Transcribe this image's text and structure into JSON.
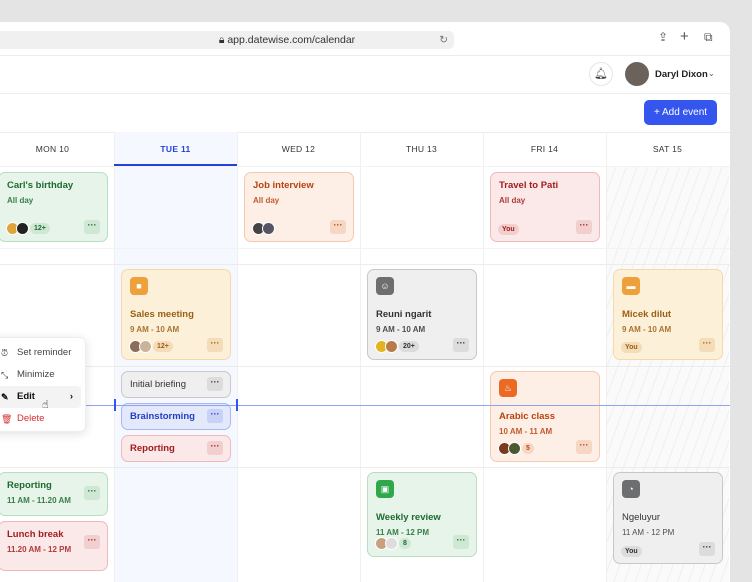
{
  "browser": {
    "url": "app.datewise.com/calendar"
  },
  "header": {
    "user_name": "Daryl Dixon",
    "add_event": "+ Add event"
  },
  "days": [
    {
      "label": "MON  10"
    },
    {
      "label": "TUE  11"
    },
    {
      "label": "WED  12"
    },
    {
      "label": "THU  13"
    },
    {
      "label": "FRI  14"
    },
    {
      "label": "SAT  15"
    }
  ],
  "events": {
    "birthday": {
      "title": "Carl's birthday",
      "time": "All day",
      "count": "12+"
    },
    "job": {
      "title": "Job interview",
      "time": "All day"
    },
    "travel": {
      "title": "Travel to Pati",
      "time": "All day",
      "who": "You"
    },
    "sales": {
      "title": "Sales meeting",
      "time": "9 AM - 10 AM",
      "count": "12+"
    },
    "reuni": {
      "title": "Reuni ngarit",
      "time": "9 AM - 10 AM",
      "count": "20+"
    },
    "micek": {
      "title": "Micek dilut",
      "time": "9 AM - 10 AM",
      "who": "You"
    },
    "briefing": {
      "title": "Initial briefing"
    },
    "brainstorm": {
      "title": "Brainstorming"
    },
    "reporting_tue": {
      "title": "Reporting"
    },
    "arabic": {
      "title": "Arabic class",
      "time": "10 AM - 11 AM",
      "count": "5"
    },
    "reporting_mon": {
      "title": "Reporting",
      "time": "11 AM - 11.20 AM"
    },
    "lunch": {
      "title": "Lunch break",
      "time": "11.20 AM - 12 PM"
    },
    "weekly": {
      "title": "Weekly review",
      "time": "11 AM - 12 PM",
      "count": "8"
    },
    "ngeluyur": {
      "title": "Ngeluyur",
      "time": "11 AM - 12 PM",
      "who": "You"
    }
  },
  "context_menu": {
    "items": [
      "Set reminder",
      "Minimize",
      "Edit",
      "Delete"
    ]
  },
  "more": "···"
}
